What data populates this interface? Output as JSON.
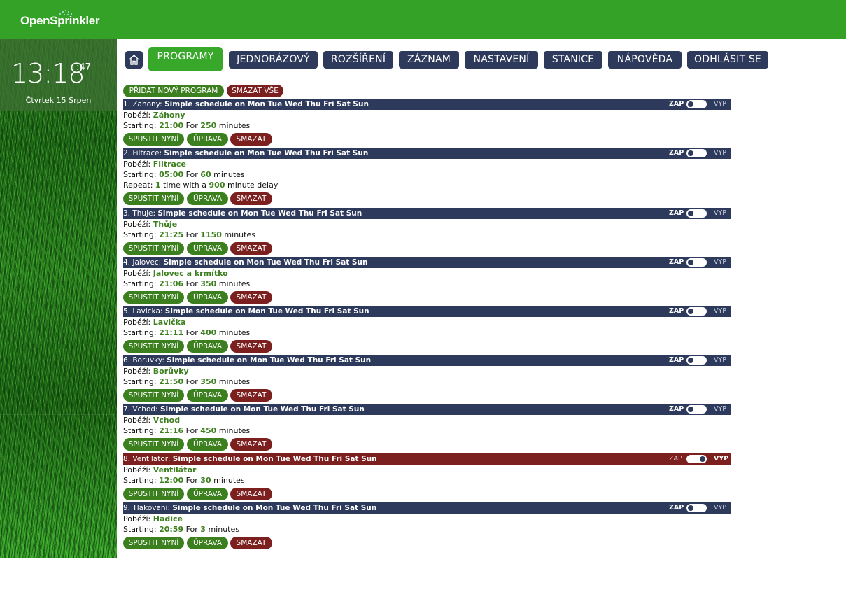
{
  "app": {
    "logo_text": "OpenSprinkler"
  },
  "clock": {
    "time": "13:18",
    "seconds": ":47",
    "date": "Čtvrtek 15 Srpen"
  },
  "nav": {
    "home_icon": "home-icon",
    "items": [
      {
        "label": "PROGRAMY",
        "active": true
      },
      {
        "label": "JEDNORÁZOVÝ",
        "active": false
      },
      {
        "label": "ROZŠÍŘENÍ",
        "active": false
      },
      {
        "label": "ZÁZNAM",
        "active": false
      },
      {
        "label": "NASTAVENÍ",
        "active": false
      },
      {
        "label": "STANICE",
        "active": false
      },
      {
        "label": "NÁPOVĚDA",
        "active": false
      },
      {
        "label": "ODHLÁSIT SE",
        "active": false
      }
    ]
  },
  "actions": {
    "add_label": "PŘIDAT NOVÝ PROGRAM",
    "delete_all_label": "SMAZAT VŠE"
  },
  "labels": {
    "runs": "Poběží:",
    "starting": "Starting:",
    "for": "For",
    "minutes": "minutes",
    "repeat": "Repeat:",
    "time_with_a": "time with a",
    "minute_delay": "minute delay",
    "on": "ZAP",
    "off": "VYP",
    "run_now": "SPUSTIT NYNÍ",
    "edit": "ÚPRAVA",
    "delete": "SMAZAT"
  },
  "colors": {
    "header_bg": "#34a226",
    "nav_bg": "#2e3a5c",
    "accent_green": "#3c7f1e",
    "danger_red": "#7b1f1f"
  },
  "programs": [
    {
      "prefix": "1. Zahony:",
      "schedule": "Simple schedule on Mon Tue Wed Thu Fri Sat Sun",
      "station": "Záhony",
      "start": "21:00",
      "duration": "250",
      "enabled": true
    },
    {
      "prefix": "2. Filtrace:",
      "schedule": "Simple schedule on Mon Tue Wed Thu Fri Sat Sun",
      "station": "Filtrace",
      "start": "05:00",
      "duration": "60",
      "enabled": true,
      "repeat": {
        "count": "1",
        "delay": "900"
      }
    },
    {
      "prefix": "3. Thuje:",
      "schedule": "Simple schedule on Mon Tue Wed Thu Fri Sat Sun",
      "station": "Thůje",
      "start": "21:25",
      "duration": "1150",
      "enabled": true
    },
    {
      "prefix": "4. Jalovec:",
      "schedule": "Simple schedule on Mon Tue Wed Thu Fri Sat Sun",
      "station": "Jalovec a krmítko",
      "start": "21:06",
      "duration": "350",
      "enabled": true
    },
    {
      "prefix": "5. Lavicka:",
      "schedule": "Simple schedule on Mon Tue Wed Thu Fri Sat Sun",
      "station": "Lavička",
      "start": "21:11",
      "duration": "400",
      "enabled": true
    },
    {
      "prefix": "6. Boruvky:",
      "schedule": "Simple schedule on Mon Tue Wed Thu Fri Sat Sun",
      "station": "Borůvky",
      "start": "21:50",
      "duration": "350",
      "enabled": true
    },
    {
      "prefix": "7. Vchod:",
      "schedule": "Simple schedule on Mon Tue Wed Thu Fri Sat Sun",
      "station": "Vchod",
      "start": "21:16",
      "duration": "450",
      "enabled": true
    },
    {
      "prefix": "8. Ventilator:",
      "schedule": "Simple schedule on Mon Tue Wed Thu Fri Sat Sun",
      "station": "Ventilátor",
      "start": "12:00",
      "duration": "30",
      "enabled": false
    },
    {
      "prefix": "9. Tlakovani:",
      "schedule": "Simple schedule on Mon Tue Wed Thu Fri Sat Sun",
      "station": "Hadice",
      "start": "20:59",
      "duration": "3",
      "enabled": true
    }
  ]
}
